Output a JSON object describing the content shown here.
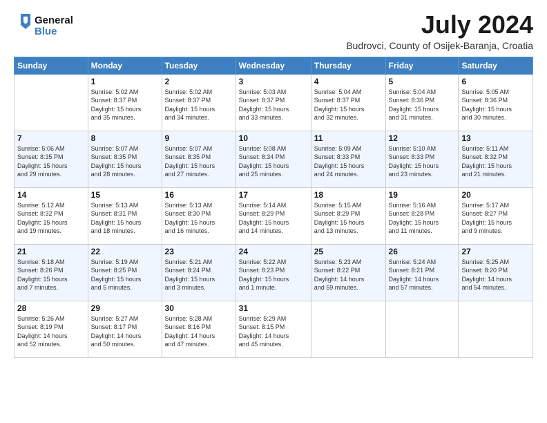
{
  "header": {
    "logo_line1": "General",
    "logo_line2": "Blue",
    "month_year": "July 2024",
    "location": "Budrovci, County of Osijek-Baranja, Croatia"
  },
  "weekdays": [
    "Sunday",
    "Monday",
    "Tuesday",
    "Wednesday",
    "Thursday",
    "Friday",
    "Saturday"
  ],
  "weeks": [
    [
      {
        "day": "",
        "info": ""
      },
      {
        "day": "1",
        "info": "Sunrise: 5:02 AM\nSunset: 8:37 PM\nDaylight: 15 hours\nand 35 minutes."
      },
      {
        "day": "2",
        "info": "Sunrise: 5:02 AM\nSunset: 8:37 PM\nDaylight: 15 hours\nand 34 minutes."
      },
      {
        "day": "3",
        "info": "Sunrise: 5:03 AM\nSunset: 8:37 PM\nDaylight: 15 hours\nand 33 minutes."
      },
      {
        "day": "4",
        "info": "Sunrise: 5:04 AM\nSunset: 8:37 PM\nDaylight: 15 hours\nand 32 minutes."
      },
      {
        "day": "5",
        "info": "Sunrise: 5:04 AM\nSunset: 8:36 PM\nDaylight: 15 hours\nand 31 minutes."
      },
      {
        "day": "6",
        "info": "Sunrise: 5:05 AM\nSunset: 8:36 PM\nDaylight: 15 hours\nand 30 minutes."
      }
    ],
    [
      {
        "day": "7",
        "info": "Sunrise: 5:06 AM\nSunset: 8:35 PM\nDaylight: 15 hours\nand 29 minutes."
      },
      {
        "day": "8",
        "info": "Sunrise: 5:07 AM\nSunset: 8:35 PM\nDaylight: 15 hours\nand 28 minutes."
      },
      {
        "day": "9",
        "info": "Sunrise: 5:07 AM\nSunset: 8:35 PM\nDaylight: 15 hours\nand 27 minutes."
      },
      {
        "day": "10",
        "info": "Sunrise: 5:08 AM\nSunset: 8:34 PM\nDaylight: 15 hours\nand 25 minutes."
      },
      {
        "day": "11",
        "info": "Sunrise: 5:09 AM\nSunset: 8:33 PM\nDaylight: 15 hours\nand 24 minutes."
      },
      {
        "day": "12",
        "info": "Sunrise: 5:10 AM\nSunset: 8:33 PM\nDaylight: 15 hours\nand 23 minutes."
      },
      {
        "day": "13",
        "info": "Sunrise: 5:11 AM\nSunset: 8:32 PM\nDaylight: 15 hours\nand 21 minutes."
      }
    ],
    [
      {
        "day": "14",
        "info": "Sunrise: 5:12 AM\nSunset: 8:32 PM\nDaylight: 15 hours\nand 19 minutes."
      },
      {
        "day": "15",
        "info": "Sunrise: 5:13 AM\nSunset: 8:31 PM\nDaylight: 15 hours\nand 18 minutes."
      },
      {
        "day": "16",
        "info": "Sunrise: 5:13 AM\nSunset: 8:30 PM\nDaylight: 15 hours\nand 16 minutes."
      },
      {
        "day": "17",
        "info": "Sunrise: 5:14 AM\nSunset: 8:29 PM\nDaylight: 15 hours\nand 14 minutes."
      },
      {
        "day": "18",
        "info": "Sunrise: 5:15 AM\nSunset: 8:29 PM\nDaylight: 15 hours\nand 13 minutes."
      },
      {
        "day": "19",
        "info": "Sunrise: 5:16 AM\nSunset: 8:28 PM\nDaylight: 15 hours\nand 11 minutes."
      },
      {
        "day": "20",
        "info": "Sunrise: 5:17 AM\nSunset: 8:27 PM\nDaylight: 15 hours\nand 9 minutes."
      }
    ],
    [
      {
        "day": "21",
        "info": "Sunrise: 5:18 AM\nSunset: 8:26 PM\nDaylight: 15 hours\nand 7 minutes."
      },
      {
        "day": "22",
        "info": "Sunrise: 5:19 AM\nSunset: 8:25 PM\nDaylight: 15 hours\nand 5 minutes."
      },
      {
        "day": "23",
        "info": "Sunrise: 5:21 AM\nSunset: 8:24 PM\nDaylight: 15 hours\nand 3 minutes."
      },
      {
        "day": "24",
        "info": "Sunrise: 5:22 AM\nSunset: 8:23 PM\nDaylight: 15 hours\nand 1 minute."
      },
      {
        "day": "25",
        "info": "Sunrise: 5:23 AM\nSunset: 8:22 PM\nDaylight: 14 hours\nand 59 minutes."
      },
      {
        "day": "26",
        "info": "Sunrise: 5:24 AM\nSunset: 8:21 PM\nDaylight: 14 hours\nand 57 minutes."
      },
      {
        "day": "27",
        "info": "Sunrise: 5:25 AM\nSunset: 8:20 PM\nDaylight: 14 hours\nand 54 minutes."
      }
    ],
    [
      {
        "day": "28",
        "info": "Sunrise: 5:26 AM\nSunset: 8:19 PM\nDaylight: 14 hours\nand 52 minutes."
      },
      {
        "day": "29",
        "info": "Sunrise: 5:27 AM\nSunset: 8:17 PM\nDaylight: 14 hours\nand 50 minutes."
      },
      {
        "day": "30",
        "info": "Sunrise: 5:28 AM\nSunset: 8:16 PM\nDaylight: 14 hours\nand 47 minutes."
      },
      {
        "day": "31",
        "info": "Sunrise: 5:29 AM\nSunset: 8:15 PM\nDaylight: 14 hours\nand 45 minutes."
      },
      {
        "day": "",
        "info": ""
      },
      {
        "day": "",
        "info": ""
      },
      {
        "day": "",
        "info": ""
      }
    ]
  ]
}
